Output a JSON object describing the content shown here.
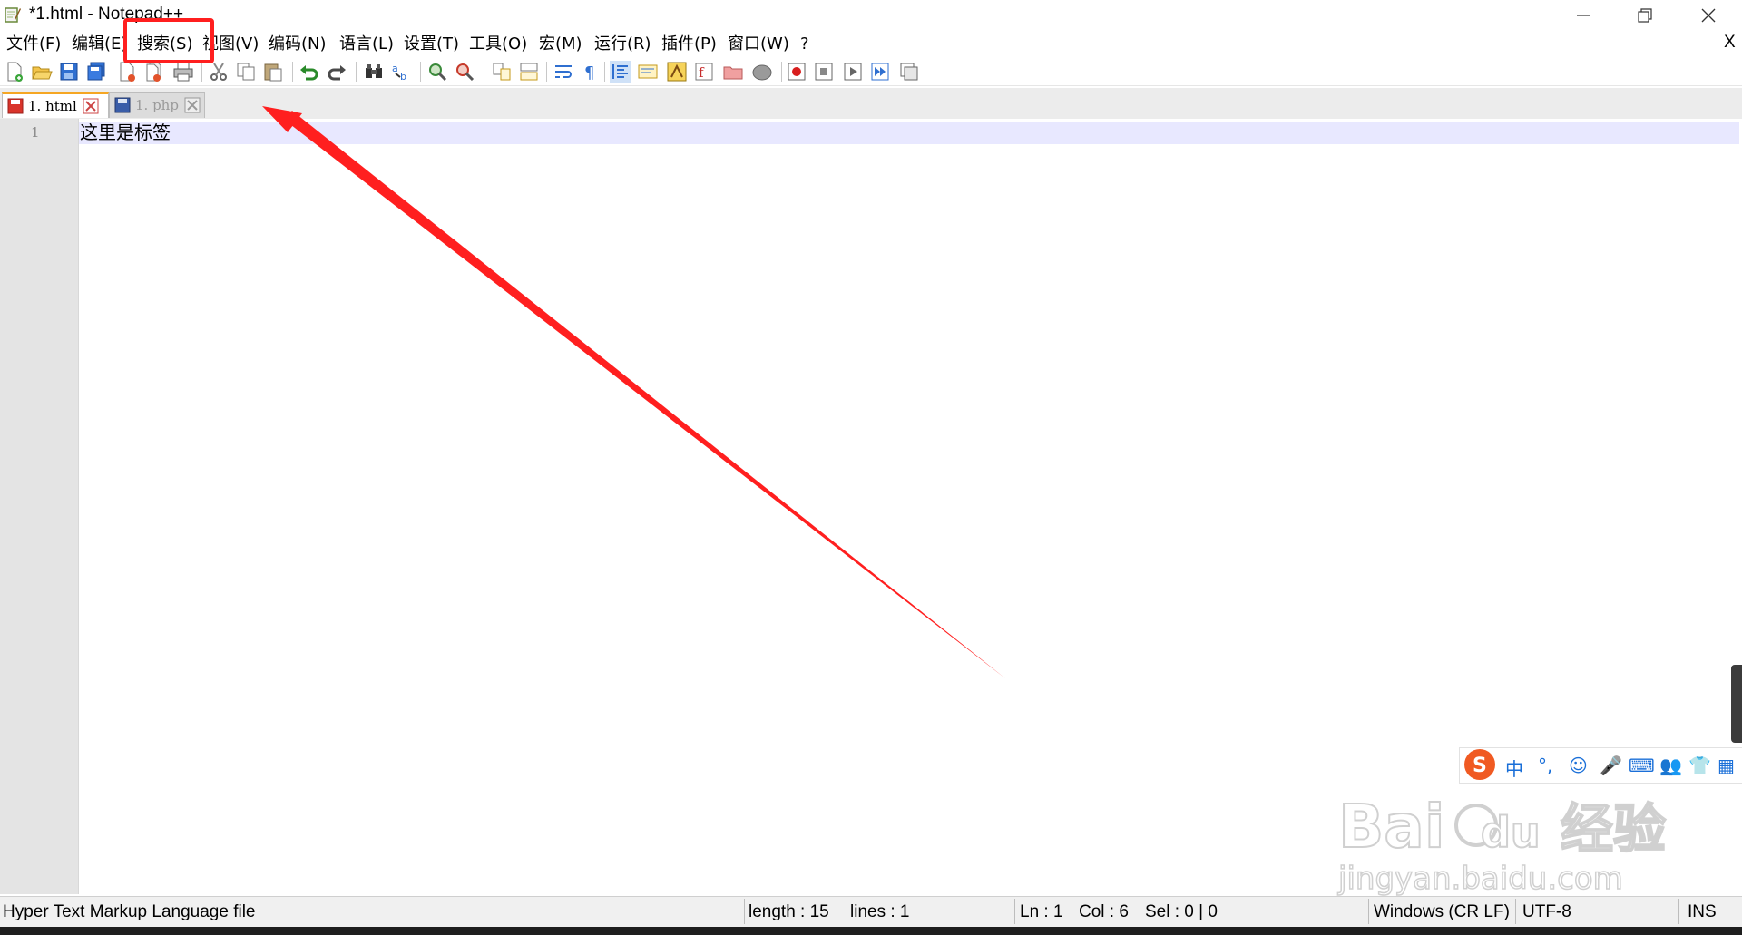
{
  "window": {
    "title": "*1.html - Notepad++",
    "controls": [
      "minimize",
      "restore",
      "close"
    ]
  },
  "menu": {
    "items": [
      "文件(F)",
      "编辑(E)",
      "搜索(S)",
      "视图(V)",
      "编码(N)",
      "语言(L)",
      "设置(T)",
      "工具(O)",
      "宏(M)",
      "运行(R)",
      "插件(P)",
      "窗口(W)",
      "?"
    ],
    "close_label": "X",
    "highlighted": "搜索(S)"
  },
  "toolbar": {
    "buttons": [
      "new-file-icon",
      "open-file-icon",
      "save-icon",
      "save-all-icon",
      "close-icon",
      "close-all-icon",
      "print-icon",
      "cut-icon",
      "copy-icon",
      "paste-icon",
      "undo-icon",
      "redo-icon",
      "find-icon",
      "replace-icon",
      "zoom-in-icon",
      "zoom-out-icon",
      "sync-vertical-icon",
      "sync-horizontal-icon",
      "word-wrap-icon",
      "show-all-chars-icon",
      "indent-guide-icon",
      "doc-map-icon",
      "function-list-icon",
      "folder-workspace-icon",
      "monitoring-icon",
      "record-macro-icon",
      "stop-record-icon",
      "play-macro-icon",
      "run-macro-multiple-icon",
      "save-macro-icon"
    ]
  },
  "tabs": [
    {
      "label": "1. html",
      "active": true,
      "color": "#d9342b"
    },
    {
      "label": "1. php",
      "active": false,
      "color": "#3a5da8"
    }
  ],
  "editor": {
    "lines": [
      {
        "number": "1",
        "text": "这里是标签"
      }
    ]
  },
  "status": {
    "file_type": "Hyper Text Markup Language file",
    "length": "length : 15",
    "lines": "lines : 1",
    "ln": "Ln : 1",
    "col": "Col : 6",
    "sel": "Sel : 0 | 0",
    "eol": "Windows (CR LF)",
    "encoding": "UTF-8",
    "mode": "INS"
  },
  "ime": {
    "items": [
      "中",
      "°,",
      "☺",
      "🎤",
      "⌨",
      "👥",
      "👕",
      "▦"
    ]
  },
  "watermark": {
    "brand": "Bai",
    "brand2": "du",
    "brand_cn": "经验",
    "url": "jingyan.baidu.com"
  },
  "colors": {
    "annotation": "#ff1f1f",
    "current_line": "#e8e8ff",
    "active_tab_accent": "#f5a623"
  }
}
